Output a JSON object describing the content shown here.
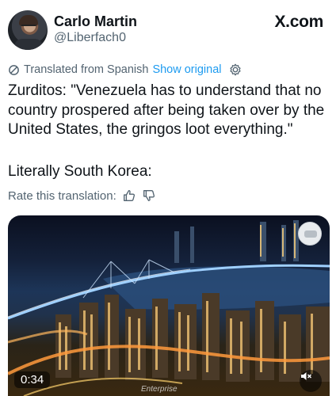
{
  "user": {
    "display_name": "Carlo Martin",
    "handle": "@Liberfach0"
  },
  "brand": {
    "label": "X.com"
  },
  "translation": {
    "notice": "Translated from Spanish",
    "show_original": "Show original",
    "rate_label": "Rate this translation:"
  },
  "tweet": {
    "text": "Zurditos: \"Venezuela has to understand that no country prospered after being taken over by the United States, the gringos loot everything.\"",
    "text2": "Literally South Korea:"
  },
  "video": {
    "timestamp": "0:34",
    "watermark": "Enterprise"
  },
  "icons": {
    "translate": "slash-circle-icon",
    "settings": "gear-icon",
    "like": "thumbs-up-icon",
    "dislike": "thumbs-down-icon",
    "mute": "speaker-muted-icon"
  },
  "colors": {
    "link": "#1d9bf0",
    "secondary_text": "#536471",
    "primary_text": "#0f1419"
  }
}
